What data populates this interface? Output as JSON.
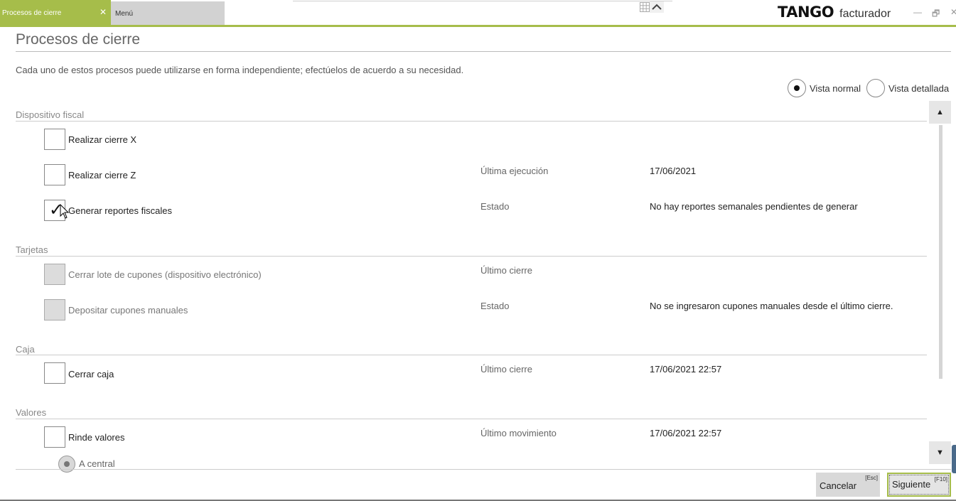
{
  "tabs": {
    "active_label": "Procesos de cierre",
    "close_glyph": "✕",
    "menu_label": "Menú"
  },
  "brand": {
    "logo": "TANGO",
    "product": "facturador",
    "accent_color": "#a6bd4a"
  },
  "window_controls": {
    "minimize": "—",
    "restore": "🗗",
    "close": "✕"
  },
  "page": {
    "title": "Procesos de cierre",
    "description": "Cada uno de estos procesos puede utilizarse en forma independiente; efectúelos de acuerdo a su necesidad."
  },
  "view_options": {
    "normal": "Vista normal",
    "detailed": "Vista detallada",
    "selected": "normal"
  },
  "sections": {
    "fiscal": {
      "label": "Dispositivo fiscal",
      "items": [
        {
          "label": "Realizar cierre X",
          "checked": false
        },
        {
          "label": "Realizar cierre Z",
          "checked": false,
          "meta_label": "Última ejecución",
          "meta_value": "17/06/2021"
        },
        {
          "label": "Generar reportes fiscales",
          "checked": true,
          "meta_label": "Estado",
          "meta_value": "No hay reportes semanales pendientes de generar"
        }
      ]
    },
    "tarjetas": {
      "label": "Tarjetas",
      "items": [
        {
          "label": "Cerrar lote de cupones (dispositivo electrónico)",
          "disabled": true,
          "meta_label": "Último cierre",
          "meta_value": ""
        },
        {
          "label": "Depositar cupones manuales",
          "disabled": true,
          "meta_label": "Estado",
          "meta_value": "No se ingresaron cupones manuales desde el último cierre."
        }
      ]
    },
    "caja": {
      "label": "Caja",
      "items": [
        {
          "label": "Cerrar caja",
          "checked": false,
          "meta_label": "Último cierre",
          "meta_value": "17/06/2021 22:57"
        }
      ]
    },
    "valores": {
      "label": "Valores",
      "items": [
        {
          "label": "Rinde valores",
          "checked": false,
          "meta_label": "Último movimiento",
          "meta_value": "17/06/2021 22:57"
        }
      ],
      "sub_option": "A central"
    }
  },
  "scroll": {
    "up": "▲",
    "down": "▼"
  },
  "footer": {
    "cancel_label": "Cancelar",
    "cancel_key": "[Esc]",
    "next_label": "Siguiente",
    "next_key": "[F10]"
  }
}
